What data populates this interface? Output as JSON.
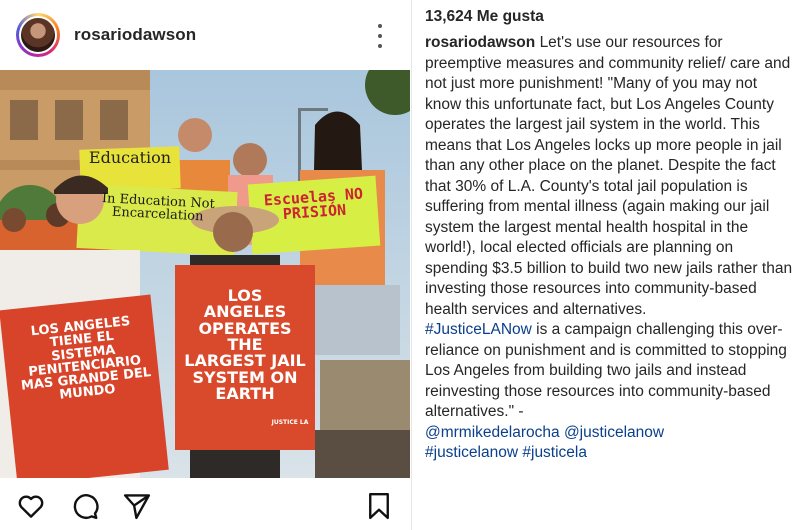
{
  "post": {
    "username": "rosariodawson",
    "more_label": "More options",
    "photo": {
      "signs": {
        "education_top": "Education",
        "education_green": "In Education Not Encarcelation",
        "escuelas": "Escuelas NO PRISIÓN",
        "red_left": "LOS ANGELES TIENE EL SISTEMA PENITENCIARIO MAS GRANDE DEL MUNDO",
        "red_right": "LOS ANGELES OPERATES THE LARGEST JAIL SYSTEM ON EARTH",
        "small_brand": "JUSTICE LA"
      }
    },
    "actions": {
      "like": "Like",
      "comment": "Comment",
      "share": "Share",
      "save": "Save"
    }
  },
  "caption_panel": {
    "likes_count": "13,624",
    "likes_label": "Me gusta",
    "caption_user": "rosariodawson",
    "caption_body": "Let's use our resources for preemptive measures and community relief/ care and not just more punishment! \"Many of you may not know this unfortunate fact, but Los Angeles County operates the largest jail system in the world. This means that Los Angeles locks up more people in jail than any other place on the planet. Despite the fact that 30% of L.A. County's total jail population is suffering from mental illness (again making our jail system the largest mental health hospital in the world!), local elected officials are planning on spending $3.5 billion to build two new jails rather than investing those resources into community-based health services and alternatives.",
    "hashtag_lead": "#JusticeLANow",
    "caption_body_2": " is a campaign challenging this over-reliance on punishment and is committed to stopping Los Angeles from building two jails and instead reinvesting those resources into community-based alternatives.\" -",
    "mention_1": "@mrmikedelarocha",
    "mention_2": "@justicelanow",
    "hashtag_1": "#justicelanow",
    "hashtag_2": "#justicela"
  }
}
